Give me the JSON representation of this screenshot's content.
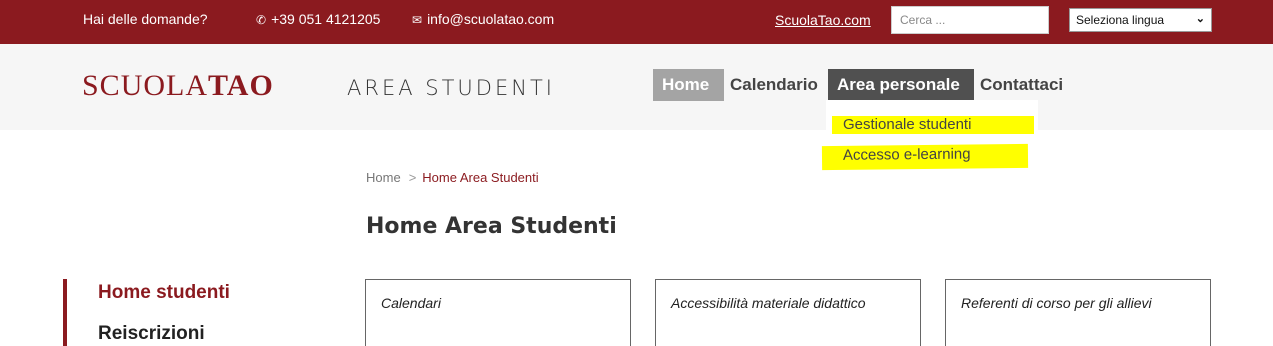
{
  "topbar": {
    "question": "Hai delle domande?",
    "phone": "+39 051 4121205",
    "email": "info@scuolatao.com",
    "site_link": "ScuolaTao.com",
    "search_placeholder": "Cerca ...",
    "language_select": "Seleziona lingua",
    "phone_icon": "phone-icon",
    "email_icon": "envelope-icon"
  },
  "header": {
    "logo_light": "SCUOLA",
    "logo_bold": "TAO",
    "area_title": "AREA STUDENTI"
  },
  "nav": {
    "items": [
      {
        "label": "Home"
      },
      {
        "label": "Calendario"
      },
      {
        "label": "Area personale"
      },
      {
        "label": "Contattaci"
      }
    ],
    "dropdown": [
      {
        "label": "Gestionale studenti"
      },
      {
        "label": "Accesso e-learning"
      }
    ]
  },
  "breadcrumb": {
    "home": "Home",
    "separator": ">",
    "current": "Home Area Studenti"
  },
  "page_title": "Home Area Studenti",
  "sidebar": {
    "items": [
      {
        "label": "Home studenti"
      },
      {
        "label": "Reiscrizioni"
      }
    ]
  },
  "cards": [
    {
      "title": "Calendari"
    },
    {
      "title": "Accessibilità materiale didattico"
    },
    {
      "title": "Referenti di corso per gli allievi"
    }
  ],
  "colors": {
    "brand": "#8b1a1f",
    "highlight": "#ffff00",
    "nav_active": "#505050"
  }
}
